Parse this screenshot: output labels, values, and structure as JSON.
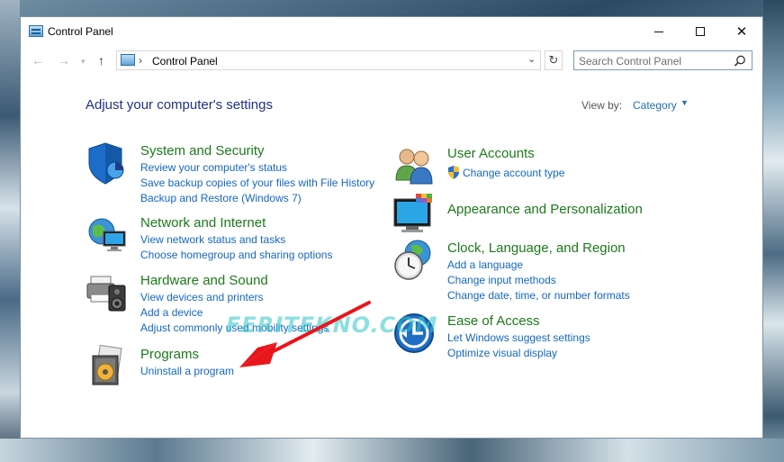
{
  "window": {
    "title": "Control Panel",
    "controls": {
      "minimize": "minimize",
      "maximize": "maximize",
      "close": "✕"
    }
  },
  "address_bar": {
    "path": "Control Panel",
    "separator": "›"
  },
  "search": {
    "placeholder": "Search Control Panel"
  },
  "main": {
    "heading": "Adjust your computer's settings",
    "view_by_label": "View by:",
    "view_by_value": "Category"
  },
  "categories": {
    "system_security": {
      "title": "System and Security",
      "icon": "shield-icon",
      "links": [
        "Review your computer's status",
        "Save backup copies of your files with File History",
        "Backup and Restore (Windows 7)"
      ]
    },
    "network_internet": {
      "title": "Network and Internet",
      "icon": "network-globe-icon",
      "links": [
        "View network status and tasks",
        "Choose homegroup and sharing options"
      ]
    },
    "hardware_sound": {
      "title": "Hardware and Sound",
      "icon": "printer-speaker-icon",
      "links": [
        "View devices and printers",
        "Add a device",
        "Adjust commonly used mobility settings"
      ]
    },
    "programs": {
      "title": "Programs",
      "icon": "programs-disc-icon",
      "links": [
        "Uninstall a program"
      ]
    },
    "user_accounts": {
      "title": "User Accounts",
      "icon": "users-icon",
      "links": [
        "Change account type"
      ]
    },
    "appearance": {
      "title": "Appearance and Personalization",
      "icon": "monitor-palette-icon",
      "links": []
    },
    "clock_region": {
      "title": "Clock, Language, and Region",
      "icon": "clock-globe-icon",
      "links": [
        "Add a language",
        "Change input methods",
        "Change date, time, or number formats"
      ]
    },
    "ease_access": {
      "title": "Ease of Access",
      "icon": "ease-of-access-icon",
      "links": [
        "Let Windows suggest settings",
        "Optimize visual display"
      ]
    }
  },
  "overlay": {
    "watermark": "FERITEKNO.COM",
    "arrow_color": "#e8161b"
  }
}
